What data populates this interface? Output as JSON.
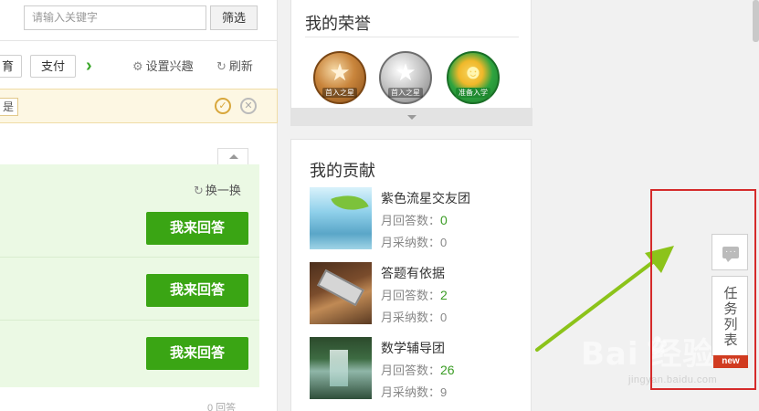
{
  "search": {
    "placeholder": "请输入关键字",
    "filter_label": "筛选"
  },
  "toolbar": {
    "tag_edu": "育",
    "tag_pay": "支付",
    "next_glyph": "›",
    "settings_label": "设置兴趣",
    "refresh_label": "刷新"
  },
  "notice": {
    "button_label": "是"
  },
  "answer_panel": {
    "change_label": "换一换",
    "answer_buttons": [
      "我来回答",
      "我来回答",
      "我来回答"
    ],
    "answers_count": "0 回答"
  },
  "honors": {
    "title": "我的荣誉",
    "medals": [
      {
        "label": "首入之星"
      },
      {
        "label": "首入之星"
      },
      {
        "label": "准备入学"
      }
    ]
  },
  "contributions": {
    "title": "我的贡献",
    "teams": [
      {
        "name": "紫色流星交友团",
        "monthly_answers_label": "月回答数：",
        "monthly_answers": "0",
        "monthly_adopted_label": "月采纳数：",
        "monthly_adopted": "0"
      },
      {
        "name": "答题有依据",
        "monthly_answers_label": "月回答数：",
        "monthly_answers": "2",
        "monthly_adopted_label": "月采纳数：",
        "monthly_adopted": "0"
      },
      {
        "name": "数学辅导团",
        "monthly_answers_label": "月回答数：",
        "monthly_answers": "26",
        "monthly_adopted_label": "月采纳数：",
        "monthly_adopted": "9"
      }
    ]
  },
  "side_tools": {
    "task_list_label": "任务列表",
    "new_badge": "new"
  },
  "watermark": {
    "main": "Bai  经验",
    "sub": "jingyan.baidu.com"
  },
  "colors": {
    "accent_green": "#3aa514",
    "highlight_red": "#d52b2b",
    "arrow_green": "#8cc31a"
  }
}
